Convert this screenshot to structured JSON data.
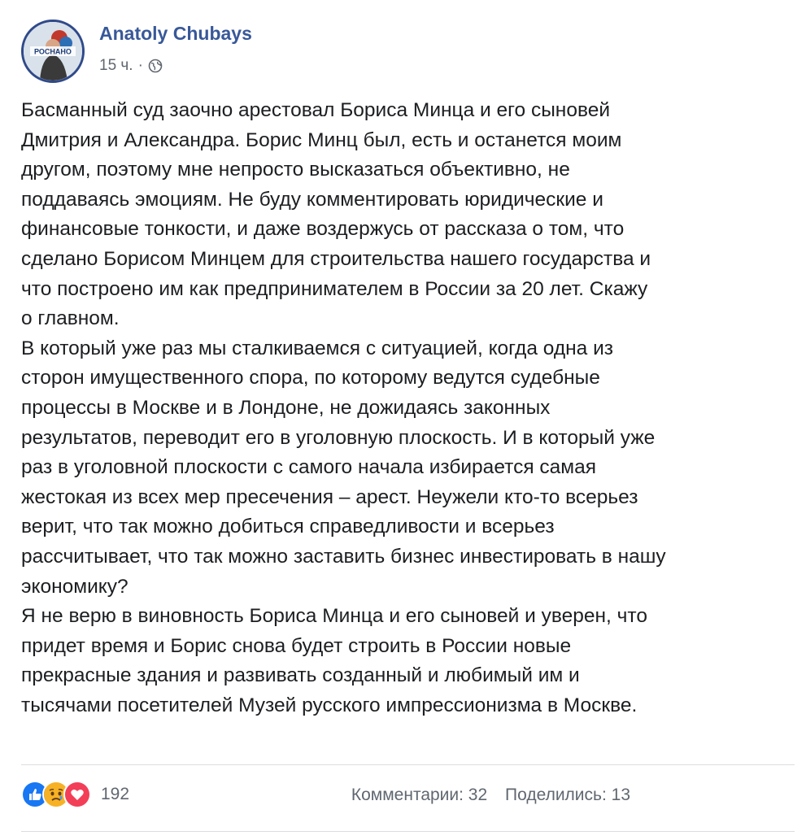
{
  "post": {
    "author": "Anatoly Chubays",
    "time": "15 ч.",
    "separator": "·",
    "avatar_text": "РОСНАНО",
    "paragraphs": [
      "Басманный суд заочно арестовал Бориса Минца и его сыновей",
      "Дмитрия и Александра. Борис Минц был, есть и останется моим",
      "другом, поэтому мне непросто высказаться объективно, не",
      "поддаваясь эмоциям. Не буду комментировать юридические и",
      "финансовые тонкости, и даже воздержусь от рассказа о том, что",
      "сделано Борисом Минцем для строительства нашего государства и",
      "что построено им как предпринимателем в России за 20 лет. Скажу",
      "о главном.",
      "В который уже раз мы сталкиваемся с ситуацией, когда одна из",
      "сторон имущественного спора, по которому ведутся судебные",
      "процессы в Москве и в Лондоне, не дожидаясь законных",
      "результатов, переводит его в уголовную плоскость. И в который уже",
      "раз в уголовной плоскости с самого начала избирается самая",
      "жестокая из всех мер пресечения – арест. Неужели кто-то всерьез",
      "верит, что так можно добиться справедливости и всерьез",
      "рассчитывает, что так можно заставить бизнес инвестировать в нашу",
      "экономику?",
      "Я не верю в виновность Бориса Минца и его сыновей и уверен, что",
      "придет время и Борис снова будет строить в России новые",
      "прекрасные здания и развивать созданный и любимый им и",
      "тысячами посетителей Музей русского импрессионизма в Москве."
    ]
  },
  "footer": {
    "reaction_icons": [
      "like-icon",
      "sad-icon",
      "love-icon"
    ],
    "reaction_count": "192",
    "comments": "Комментарии: 32",
    "shares": "Поделились: 13"
  },
  "colors": {
    "author": "#385898",
    "meta": "#616770",
    "like": "#1877f2",
    "love": "#f33e58",
    "sad": "#f7b125"
  }
}
